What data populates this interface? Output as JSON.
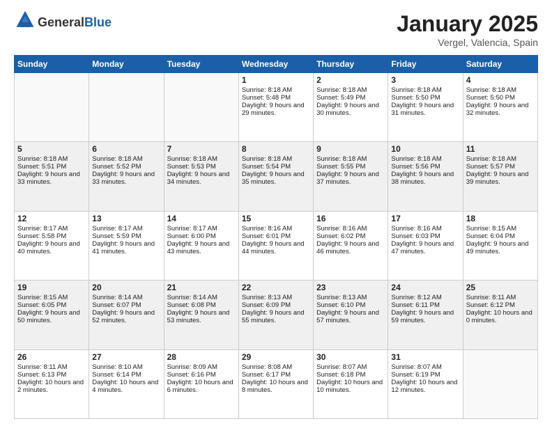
{
  "header": {
    "logo_general": "General",
    "logo_blue": "Blue",
    "month_title": "January 2025",
    "location": "Vergel, Valencia, Spain"
  },
  "days_of_week": [
    "Sunday",
    "Monday",
    "Tuesday",
    "Wednesday",
    "Thursday",
    "Friday",
    "Saturday"
  ],
  "weeks": [
    [
      {
        "day": "",
        "content": ""
      },
      {
        "day": "",
        "content": ""
      },
      {
        "day": "",
        "content": ""
      },
      {
        "day": "1",
        "content": "Sunrise: 8:18 AM\nSunset: 5:48 PM\nDaylight: 9 hours and 29 minutes."
      },
      {
        "day": "2",
        "content": "Sunrise: 8:18 AM\nSunset: 5:49 PM\nDaylight: 9 hours and 30 minutes."
      },
      {
        "day": "3",
        "content": "Sunrise: 8:18 AM\nSunset: 5:50 PM\nDaylight: 9 hours and 31 minutes."
      },
      {
        "day": "4",
        "content": "Sunrise: 8:18 AM\nSunset: 5:50 PM\nDaylight: 9 hours and 32 minutes."
      }
    ],
    [
      {
        "day": "5",
        "content": "Sunrise: 8:18 AM\nSunset: 5:51 PM\nDaylight: 9 hours and 33 minutes."
      },
      {
        "day": "6",
        "content": "Sunrise: 8:18 AM\nSunset: 5:52 PM\nDaylight: 9 hours and 33 minutes."
      },
      {
        "day": "7",
        "content": "Sunrise: 8:18 AM\nSunset: 5:53 PM\nDaylight: 9 hours and 34 minutes."
      },
      {
        "day": "8",
        "content": "Sunrise: 8:18 AM\nSunset: 5:54 PM\nDaylight: 9 hours and 35 minutes."
      },
      {
        "day": "9",
        "content": "Sunrise: 8:18 AM\nSunset: 5:55 PM\nDaylight: 9 hours and 37 minutes."
      },
      {
        "day": "10",
        "content": "Sunrise: 8:18 AM\nSunset: 5:56 PM\nDaylight: 9 hours and 38 minutes."
      },
      {
        "day": "11",
        "content": "Sunrise: 8:18 AM\nSunset: 5:57 PM\nDaylight: 9 hours and 39 minutes."
      }
    ],
    [
      {
        "day": "12",
        "content": "Sunrise: 8:17 AM\nSunset: 5:58 PM\nDaylight: 9 hours and 40 minutes."
      },
      {
        "day": "13",
        "content": "Sunrise: 8:17 AM\nSunset: 5:59 PM\nDaylight: 9 hours and 41 minutes."
      },
      {
        "day": "14",
        "content": "Sunrise: 8:17 AM\nSunset: 6:00 PM\nDaylight: 9 hours and 43 minutes."
      },
      {
        "day": "15",
        "content": "Sunrise: 8:16 AM\nSunset: 6:01 PM\nDaylight: 9 hours and 44 minutes."
      },
      {
        "day": "16",
        "content": "Sunrise: 8:16 AM\nSunset: 6:02 PM\nDaylight: 9 hours and 46 minutes."
      },
      {
        "day": "17",
        "content": "Sunrise: 8:16 AM\nSunset: 6:03 PM\nDaylight: 9 hours and 47 minutes."
      },
      {
        "day": "18",
        "content": "Sunrise: 8:15 AM\nSunset: 6:04 PM\nDaylight: 9 hours and 49 minutes."
      }
    ],
    [
      {
        "day": "19",
        "content": "Sunrise: 8:15 AM\nSunset: 6:05 PM\nDaylight: 9 hours and 50 minutes."
      },
      {
        "day": "20",
        "content": "Sunrise: 8:14 AM\nSunset: 6:07 PM\nDaylight: 9 hours and 52 minutes."
      },
      {
        "day": "21",
        "content": "Sunrise: 8:14 AM\nSunset: 6:08 PM\nDaylight: 9 hours and 53 minutes."
      },
      {
        "day": "22",
        "content": "Sunrise: 8:13 AM\nSunset: 6:09 PM\nDaylight: 9 hours and 55 minutes."
      },
      {
        "day": "23",
        "content": "Sunrise: 8:13 AM\nSunset: 6:10 PM\nDaylight: 9 hours and 57 minutes."
      },
      {
        "day": "24",
        "content": "Sunrise: 8:12 AM\nSunset: 6:11 PM\nDaylight: 9 hours and 59 minutes."
      },
      {
        "day": "25",
        "content": "Sunrise: 8:11 AM\nSunset: 6:12 PM\nDaylight: 10 hours and 0 minutes."
      }
    ],
    [
      {
        "day": "26",
        "content": "Sunrise: 8:11 AM\nSunset: 6:13 PM\nDaylight: 10 hours and 2 minutes."
      },
      {
        "day": "27",
        "content": "Sunrise: 8:10 AM\nSunset: 6:14 PM\nDaylight: 10 hours and 4 minutes."
      },
      {
        "day": "28",
        "content": "Sunrise: 8:09 AM\nSunset: 6:16 PM\nDaylight: 10 hours and 6 minutes."
      },
      {
        "day": "29",
        "content": "Sunrise: 8:08 AM\nSunset: 6:17 PM\nDaylight: 10 hours and 8 minutes."
      },
      {
        "day": "30",
        "content": "Sunrise: 8:07 AM\nSunset: 6:18 PM\nDaylight: 10 hours and 10 minutes."
      },
      {
        "day": "31",
        "content": "Sunrise: 8:07 AM\nSunset: 6:19 PM\nDaylight: 10 hours and 12 minutes."
      },
      {
        "day": "",
        "content": ""
      }
    ]
  ]
}
